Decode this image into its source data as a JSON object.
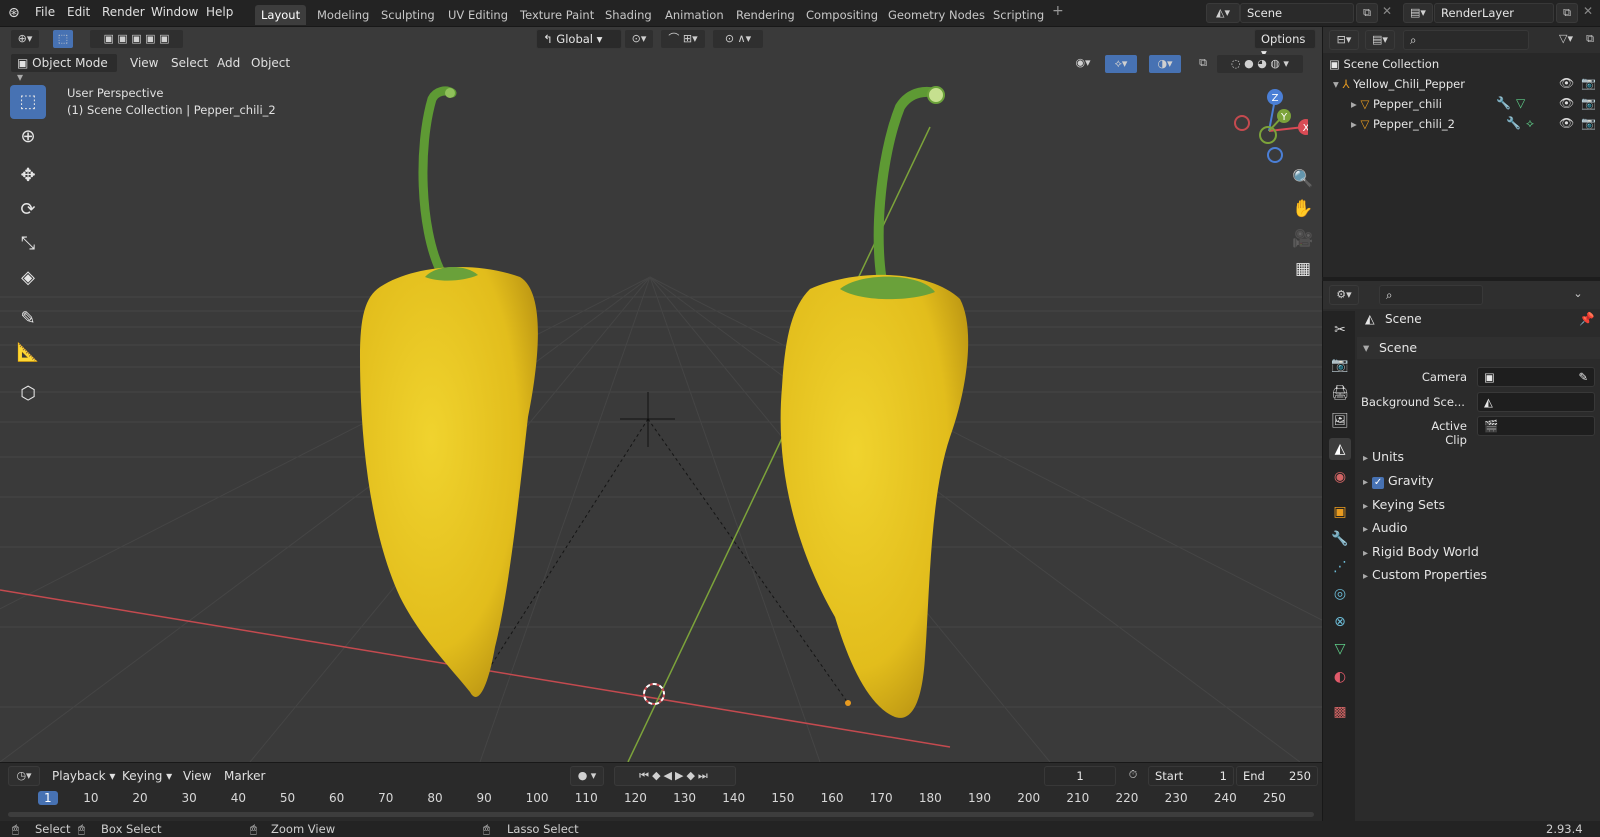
{
  "menu": {
    "file": "File",
    "edit": "Edit",
    "render": "Render",
    "window": "Window",
    "help": "Help"
  },
  "workspaces": [
    "Layout",
    "Modeling",
    "Sculpting",
    "UV Editing",
    "Texture Paint",
    "Shading",
    "Animation",
    "Rendering",
    "Compositing",
    "Geometry Nodes",
    "Scripting"
  ],
  "scene_name": "Scene",
  "render_layer": "RenderLayer",
  "toolbar": {
    "transform_orientation": "Global",
    "options_label": "Options"
  },
  "viewport": {
    "mode": "Object Mode",
    "header_menus": {
      "view": "View",
      "select": "Select",
      "add": "Add",
      "object": "Object"
    },
    "overlay_line1": "User Perspective",
    "overlay_line2": "(1) Scene Collection | Pepper_chili_2",
    "gizmo": {
      "x": "X",
      "y": "Y",
      "z": "Z"
    }
  },
  "outliner": {
    "root": "Scene Collection",
    "collection": "Yellow_Chili_Pepper",
    "items": [
      {
        "label": "Pepper_chili"
      },
      {
        "label": "Pepper_chili_2"
      }
    ]
  },
  "properties": {
    "context": "Scene",
    "panel_title": "Scene",
    "fields": {
      "camera": "Camera",
      "background_scene": "Background Sce...",
      "active_clip": "Active Clip"
    },
    "sections": {
      "units": "Units",
      "gravity": "Gravity",
      "keying_sets": "Keying Sets",
      "audio": "Audio",
      "rigid_body": "Rigid Body World",
      "custom_props": "Custom Properties"
    },
    "gravity_checked": true
  },
  "timeline": {
    "menus": {
      "playback": "Playback",
      "keying": "Keying",
      "view": "View",
      "marker": "Marker"
    },
    "current_frame": "1",
    "start_label": "Start",
    "start_value": "1",
    "end_label": "End",
    "end_value": "250",
    "ticks": [
      "1",
      "10",
      "20",
      "30",
      "40",
      "50",
      "60",
      "70",
      "80",
      "90",
      "100",
      "110",
      "120",
      "130",
      "140",
      "150",
      "160",
      "170",
      "180",
      "190",
      "200",
      "210",
      "220",
      "230",
      "240",
      "250"
    ]
  },
  "status": {
    "select": "Select",
    "box_select": "Box Select",
    "zoom_view": "Zoom View",
    "lasso_select": "Lasso Select",
    "version": "2.93.4"
  },
  "colors": {
    "accent": "#4772b3",
    "pepper": "#e6c21f",
    "stem": "#6aa13a",
    "x_axis": "#c44a4f",
    "y_axis": "#7ca33a"
  }
}
